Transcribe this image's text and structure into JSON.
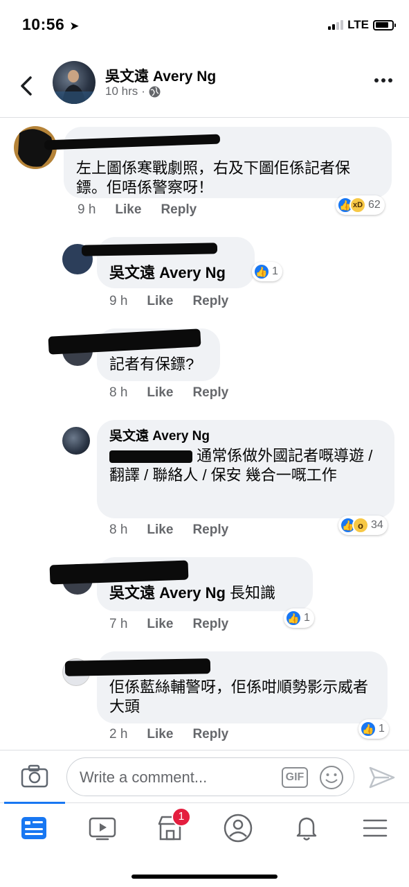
{
  "status_bar": {
    "time": "10:56",
    "network": "LTE"
  },
  "post_header": {
    "author": "吳文遠 Avery Ng",
    "time": "10 hrs",
    "separator": "·"
  },
  "comments": [
    {
      "text": "左上圖係寒戰劇照，右及下圖佢係記者保鏢。佢唔係警察呀！",
      "time": "9 h",
      "like": "Like",
      "reply": "Reply",
      "reaction_count": "62"
    },
    {
      "tag": "吳文遠 Avery Ng",
      "time": "9 h",
      "like": "Like",
      "reply": "Reply",
      "reaction_count": "1"
    },
    {
      "text": "記者有保鏢?",
      "time": "8 h",
      "like": "Like",
      "reply": "Reply"
    },
    {
      "author": "吳文遠 Avery Ng",
      "text": "通常係做外國記者嘅導遊 / 翻譯 / 聯絡人 / 保安 幾合一嘅工作",
      "time": "8 h",
      "like": "Like",
      "reply": "Reply",
      "reaction_count": "34"
    },
    {
      "tag": "吳文遠 Avery Ng",
      "text": " 長知識",
      "time": "7 h",
      "like": "Like",
      "reply": "Reply",
      "reaction_count": "1"
    },
    {
      "text": "佢係藍絲輔警呀，佢係咁順勢影示威者大頭",
      "time": "2 h",
      "like": "Like",
      "reply": "Reply",
      "reaction_count": "1"
    }
  ],
  "composer": {
    "placeholder": "Write a comment...",
    "gif_label": "GIF"
  },
  "tabbar": {
    "marketplace_badge": "1"
  },
  "colors": {
    "accent": "#1877f2",
    "bubble": "#f0f2f5",
    "badge": "#e41e3f"
  },
  "icons": [
    "back-icon",
    "globe-icon",
    "more-icon",
    "camera-icon",
    "gif-icon",
    "emoji-icon",
    "send-icon",
    "news-feed-icon",
    "watch-icon",
    "marketplace-icon",
    "profile-icon",
    "notifications-icon",
    "menu-icon"
  ]
}
